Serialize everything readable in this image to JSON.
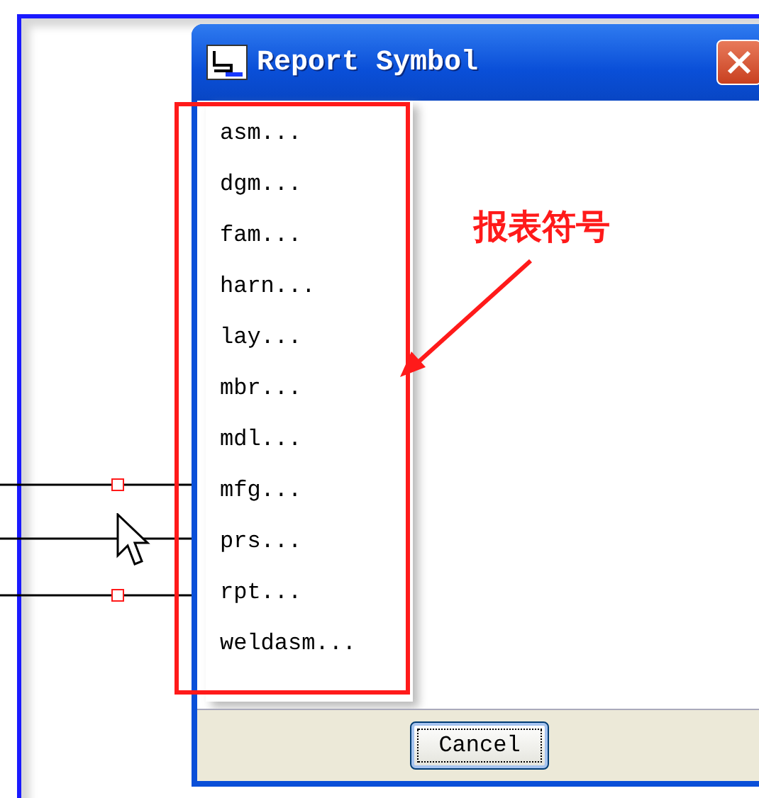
{
  "dialog": {
    "title": "Report Symbol",
    "items": [
      "asm...",
      "dgm...",
      "fam...",
      "harn...",
      "lay...",
      "mbr...",
      "mdl...",
      "mfg...",
      "prs...",
      "rpt...",
      "weldasm..."
    ],
    "buttons": [
      "Cancel"
    ]
  },
  "annotation": {
    "label": "报表符号"
  }
}
